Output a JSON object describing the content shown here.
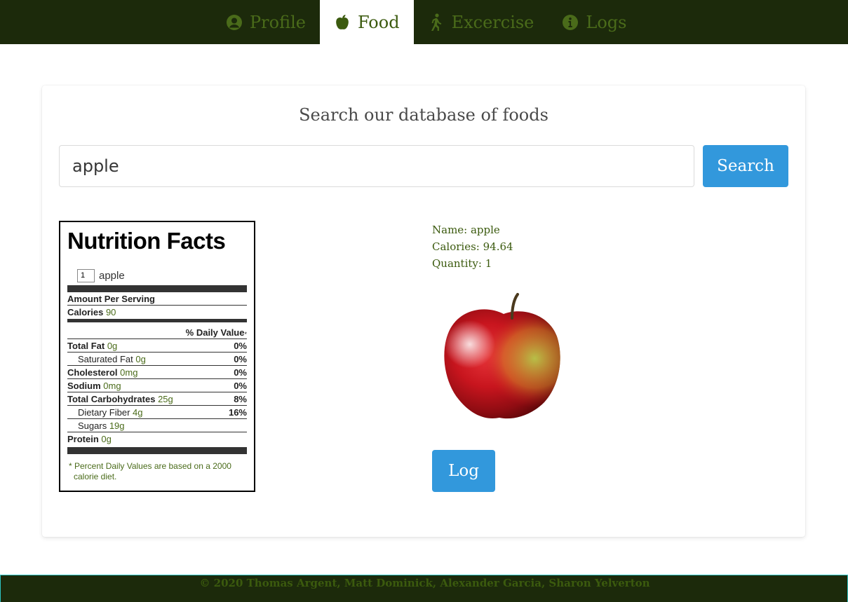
{
  "nav": {
    "tabs": [
      {
        "label": "Profile",
        "icon": "user-circle-icon"
      },
      {
        "label": "Food",
        "icon": "apple-icon",
        "active": true
      },
      {
        "label": "Excercise",
        "icon": "walking-icon"
      },
      {
        "label": "Logs",
        "icon": "info-circle-icon"
      }
    ],
    "colors": {
      "bar": "#1c2a0b",
      "tab_text": "#4a6b1a",
      "active_bg": "#ffffff"
    }
  },
  "search": {
    "title": "Search our database of foods",
    "value": "apple",
    "button_label": "Search",
    "button_color": "#3298dc"
  },
  "nutrition": {
    "title": "Nutrition Facts",
    "quantity": "1",
    "serving_name": "apple",
    "amount_per_serving": "Amount Per Serving",
    "calories_label": "Calories",
    "calories_value": "90",
    "daily_value_header": "% Daily Value",
    "daily_value_star": "*",
    "rows": [
      {
        "label": "Total Fat",
        "value": "0g",
        "dv": "0%"
      },
      {
        "label": "Saturated Fat",
        "value": "0g",
        "dv": "0%"
      },
      {
        "label": "Cholesterol",
        "value": "0mg",
        "dv": "0%"
      },
      {
        "label": "Sodium",
        "value": "0mg",
        "dv": "0%"
      },
      {
        "label": "Total Carbohydrates",
        "value": "25g",
        "dv": "8%"
      },
      {
        "label": "Dietary Fiber",
        "value": "4g",
        "dv": "16%"
      },
      {
        "label": "Sugars",
        "value": "19g",
        "dv": ""
      },
      {
        "label": "Protein",
        "value": "0g",
        "dv": ""
      }
    ],
    "footnote_line1": "* Percent Daily Values are based on a 2000",
    "footnote_line2": "calorie diet."
  },
  "details": {
    "name_line": "Name: apple",
    "calories_line": "Calories: 94.64",
    "quantity_line": "Quantity: 1",
    "image": "apple-photo",
    "log_label": "Log"
  },
  "footer": {
    "text": "© 2020 Thomas Argent, Matt Dominick, Alexander Garcia, Sharon Yelverton"
  }
}
